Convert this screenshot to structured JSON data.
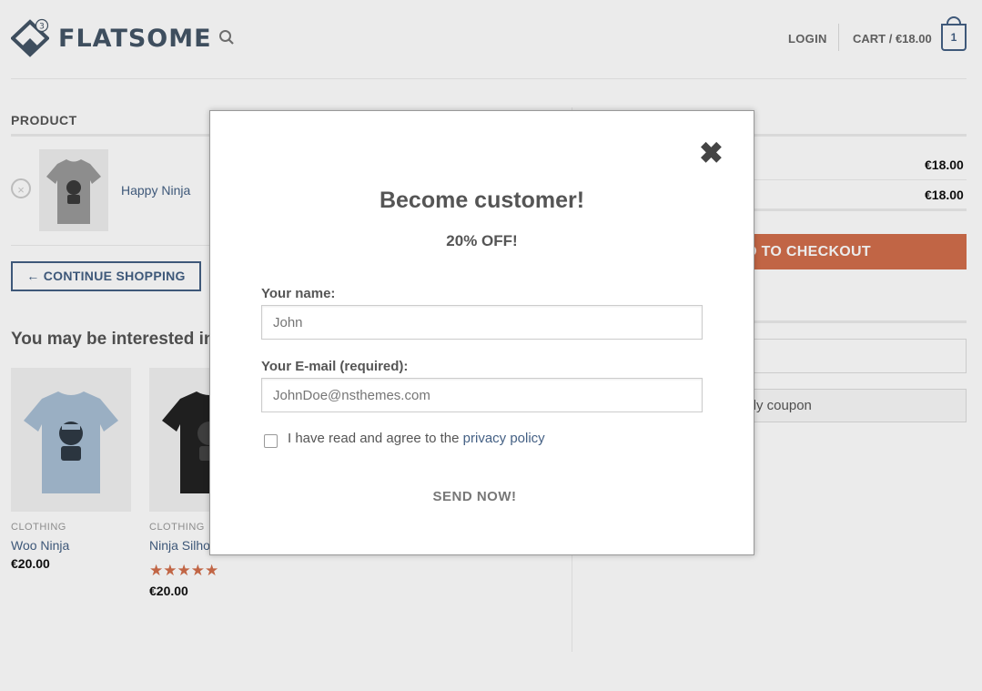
{
  "header": {
    "logo_text": "FLATSOME",
    "logo_badge": "3",
    "login_label": "LOGIN",
    "cart_label": "CART / €18.00",
    "cart_count": "1"
  },
  "cart": {
    "column_product": "PRODUCT",
    "remove_symbol": "×",
    "item_name": "Happy Ninja",
    "continue_label": "← CONTINUE SHOPPING"
  },
  "related": {
    "heading": "You may be interested in...",
    "products": [
      {
        "category": "CLOTHING",
        "name": "Woo Ninja",
        "price": "€20.00",
        "shirt_color": "#a8bed4"
      },
      {
        "category": "CLOTHING",
        "name": "Ninja Silho",
        "price": "€20.00",
        "shirt_color": "#222222",
        "rating": "★★★★★"
      }
    ]
  },
  "totals": {
    "subtotal": "€18.00",
    "total": "€18.00",
    "checkout_label": "D TO CHECKOUT",
    "coupon_label": "pply coupon"
  },
  "popup": {
    "close_symbol": "✖",
    "title": "Become customer!",
    "subtitle": "20% OFF!",
    "name_label": "Your name:",
    "name_placeholder": "John",
    "email_label": "Your E-mail (required):",
    "email_placeholder": "JohnDoe@nsthemes.com",
    "agree_text": "I have read and agree to the ",
    "privacy_link": "privacy policy",
    "send_label": "SEND NOW!"
  },
  "colors": {
    "primary": "#446084",
    "accent": "#d26e4b"
  }
}
